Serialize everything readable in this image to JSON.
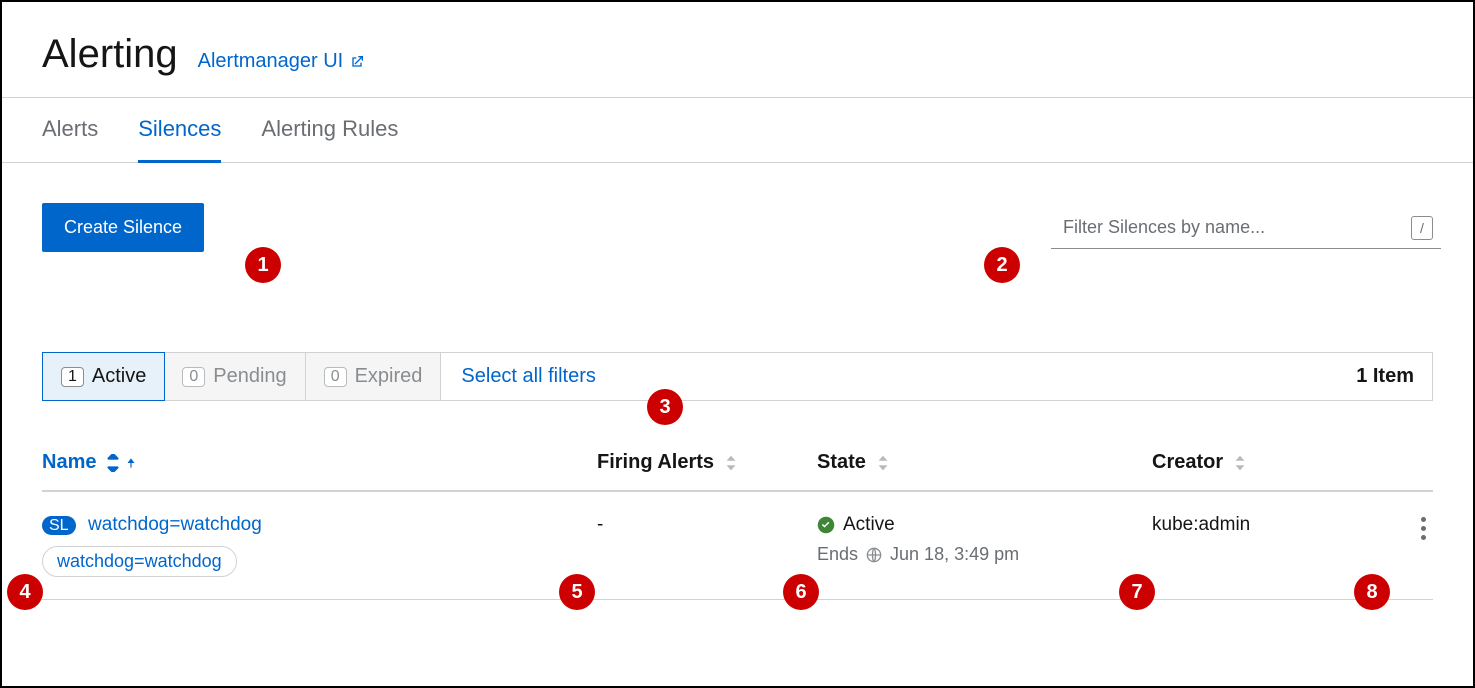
{
  "header": {
    "title": "Alerting",
    "external_link": "Alertmanager UI"
  },
  "tabs": {
    "alerts": "Alerts",
    "silences": "Silences",
    "rules": "Alerting Rules"
  },
  "toolbar": {
    "create_label": "Create Silence",
    "search_placeholder": "Filter Silences by name...",
    "key_hint": "/"
  },
  "filters": {
    "active_count": "1",
    "active_label": "Active",
    "pending_count": "0",
    "pending_label": "Pending",
    "expired_count": "0",
    "expired_label": "Expired",
    "select_all": "Select all filters",
    "item_count": "1 Item"
  },
  "columns": {
    "name": "Name",
    "firing": "Firing Alerts",
    "state": "State",
    "creator": "Creator"
  },
  "rows": [
    {
      "badge": "SL",
      "name": "watchdog=watchdog",
      "label": "watchdog=watchdog",
      "firing": "-",
      "state": "Active",
      "ends_prefix": "Ends",
      "ends_time": "Jun 18, 3:49 pm",
      "creator": "kube:admin"
    }
  ],
  "callouts": [
    "1",
    "2",
    "3",
    "4",
    "5",
    "6",
    "7",
    "8"
  ]
}
